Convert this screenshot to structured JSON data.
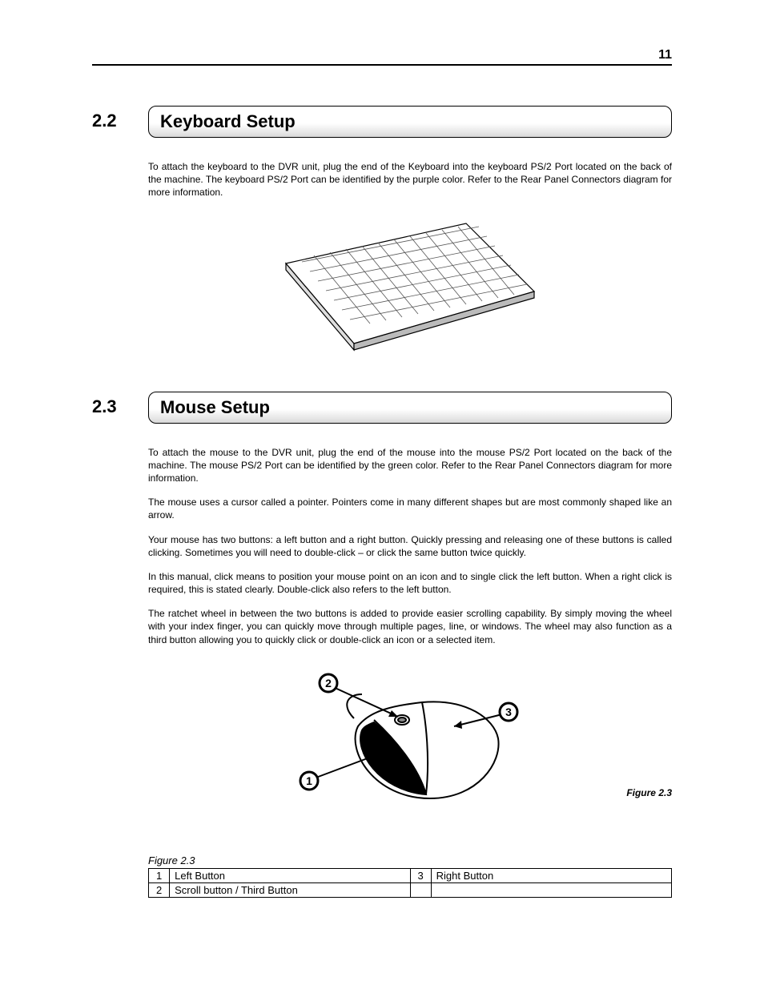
{
  "page_number": "11",
  "sections": {
    "keyboard": {
      "number": "2.2",
      "title": "Keyboard Setup",
      "p1": "To attach the keyboard to the DVR unit, plug the end of the Keyboard into the keyboard PS/2 Port located on the back of the machine. The keyboard PS/2 Port can be identified by the purple color. Refer to the Rear Panel Connectors diagram for more information."
    },
    "mouse": {
      "number": "2.3",
      "title": "Mouse Setup",
      "p1": "To attach the mouse to the DVR unit, plug the end of the mouse into the mouse PS/2 Port located on the back of the machine. The mouse PS/2 Port can be identified by the green color. Refer to the Rear Panel Connectors diagram for more information.",
      "p2": "The mouse uses a cursor called a pointer. Pointers come in many different shapes but are most commonly shaped like an arrow.",
      "p3": "Your mouse has two buttons: a left button and a right button. Quickly pressing and releasing one of these buttons is called clicking. Sometimes you will need to double-click – or click the same button twice quickly.",
      "p4": "In this manual, click means to position your mouse point on an icon and to single click the left button. When a right click is required, this is stated clearly. Double-click also refers to the left button.",
      "p5": "The ratchet wheel in between the two buttons is added to provide easier scrolling capability. By simply moving the wheel with your index finger, you can quickly move through multiple pages, line, or windows. The wheel may also function as a third button allowing you to quickly click or double-click an icon or a selected item.",
      "figure_caption": "Figure 2.3"
    }
  },
  "callouts": {
    "one": "1",
    "two": "2",
    "three": "3"
  },
  "table": {
    "caption": "Figure 2.3",
    "r1c1": "1",
    "r1c2": "Left Button",
    "r1c3": "3",
    "r1c4": "Right Button",
    "r2c1": "2",
    "r2c2": "Scroll button / Third Button",
    "r2c3": "",
    "r2c4": ""
  }
}
